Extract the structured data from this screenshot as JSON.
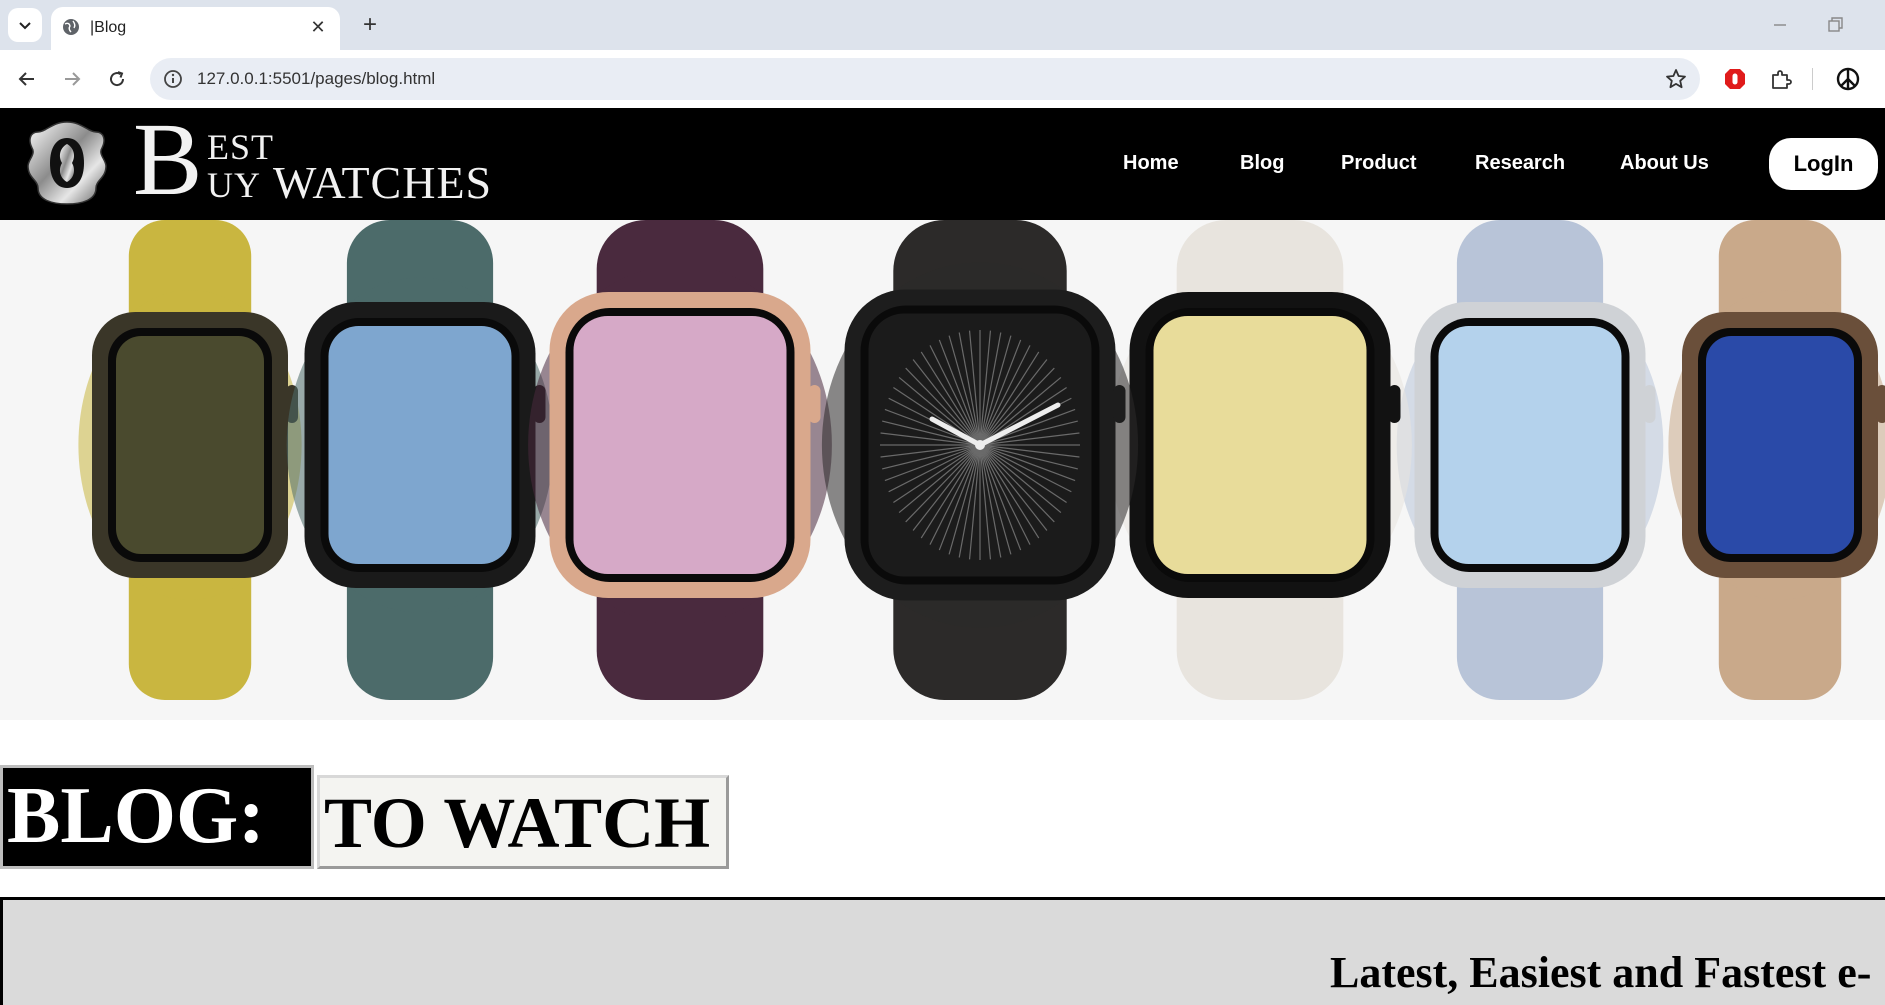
{
  "browser": {
    "tab_title": "|Blog",
    "tab_close": "✕",
    "new_tab": "+",
    "url": "127.0.0.1:5501/pages/blog.html"
  },
  "site": {
    "logo": {
      "big_letter": "B",
      "line1": "EST",
      "line2": "UY",
      "line3": "WATCHES"
    },
    "nav": [
      "Home",
      "Blog",
      "Product",
      "Research",
      "About Us"
    ],
    "login_label": "LogIn"
  },
  "hero": {
    "watches": [
      {
        "name": "gold-titanium-braided",
        "band": "#c9b640",
        "case": "#3a3628",
        "face": "#4a4a2e"
      },
      {
        "name": "jet-black-teal",
        "band": "#4c6b6a",
        "case": "#1a1a1a",
        "face": "#7ea6cf"
      },
      {
        "name": "rose-gold-plum",
        "band": "#4a2a3e",
        "case": "#d9a88c",
        "face": "#d6a9c7"
      },
      {
        "name": "slate-milanese",
        "band": "#2c2a29",
        "case": "#1d1d1d",
        "face": "#1b1b1b"
      },
      {
        "name": "silver-starlight",
        "band": "#e8e4de",
        "case": "#121212",
        "face": "#e8dc9a"
      },
      {
        "name": "silver-blue-loop",
        "band": "#b8c4d8",
        "case": "#cfd2d6",
        "face": "#b4d2ec"
      },
      {
        "name": "gold-link-bracelet",
        "band": "#c9a98a",
        "case": "#6a4f3a",
        "face": "#2a4aa8"
      }
    ]
  },
  "blog": {
    "heading_left": "BLOG:",
    "heading_right": "TO WATCH",
    "intro_text": "Latest, Easiest and Fastest e-"
  }
}
